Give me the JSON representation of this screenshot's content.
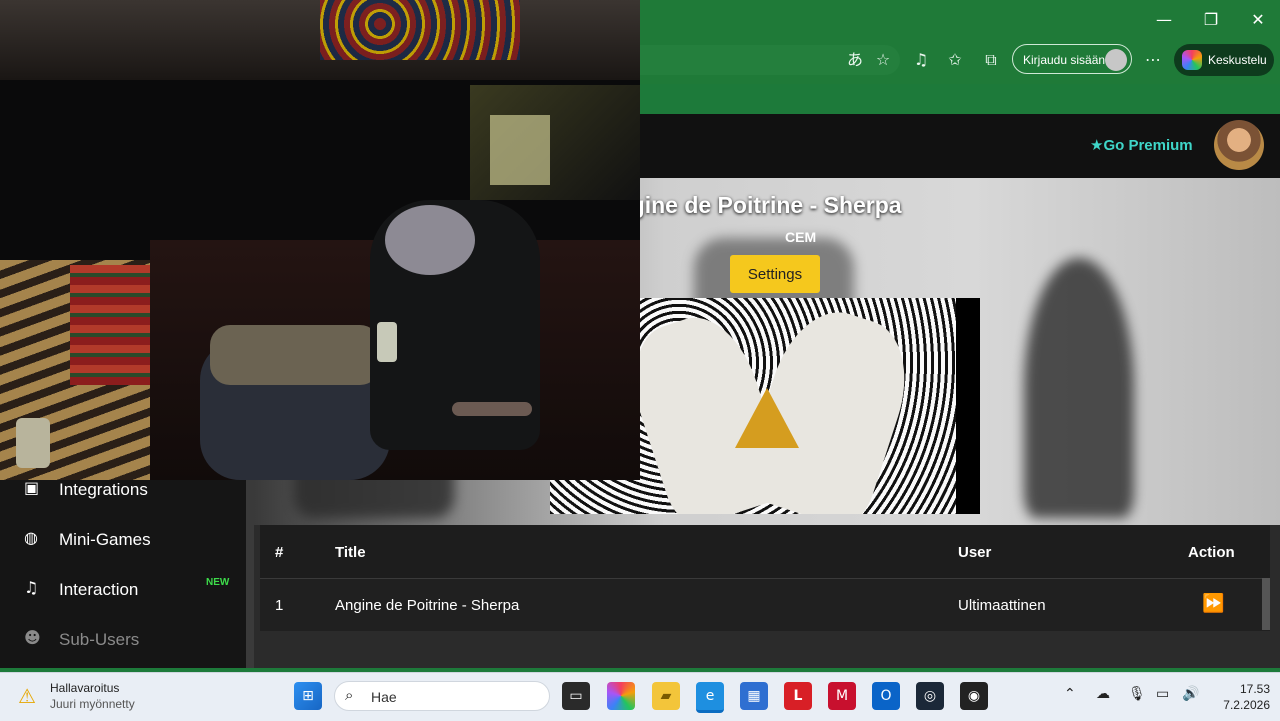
{
  "browser": {
    "signin_label": "Kirjaudu sisään",
    "copilot_label": "Keskustelu",
    "window_controls": [
      "minimize-icon",
      "restore-icon",
      "close-icon"
    ]
  },
  "site": {
    "premium_label": "Go Premium",
    "song_title": "Angine de Poitrine - Sherpa",
    "requested_by": "CEM",
    "settings_label": "Settings"
  },
  "sidebar": {
    "items": [
      {
        "label": "Integrations",
        "icon": "chat-icon"
      },
      {
        "label": "Mini-Games",
        "icon": "gamepad-icon"
      },
      {
        "label": "Interaction",
        "icon": "music-icon",
        "badge": "NEW"
      },
      {
        "label": "Sub-Users",
        "icon": "users-icon"
      }
    ]
  },
  "table": {
    "headers": [
      "#",
      "Title",
      "User",
      "Action"
    ],
    "rows": [
      {
        "num": "1",
        "title": "Angine de Poitrine - Sherpa",
        "user": "Ultimaattinen",
        "action": "fast-forward-icon"
      }
    ]
  },
  "taskbar": {
    "weather_title": "Hallavaroitus",
    "weather_sub": "Juuri myönnetty",
    "search_placeholder": "Hae",
    "time": "17.53",
    "date": "7.2.2026"
  },
  "colors": {
    "browser_green": "#1f7a38",
    "premium_teal": "#3fd6c9",
    "settings_yellow": "#f5c81d",
    "badge_green": "#3ddc4a"
  }
}
